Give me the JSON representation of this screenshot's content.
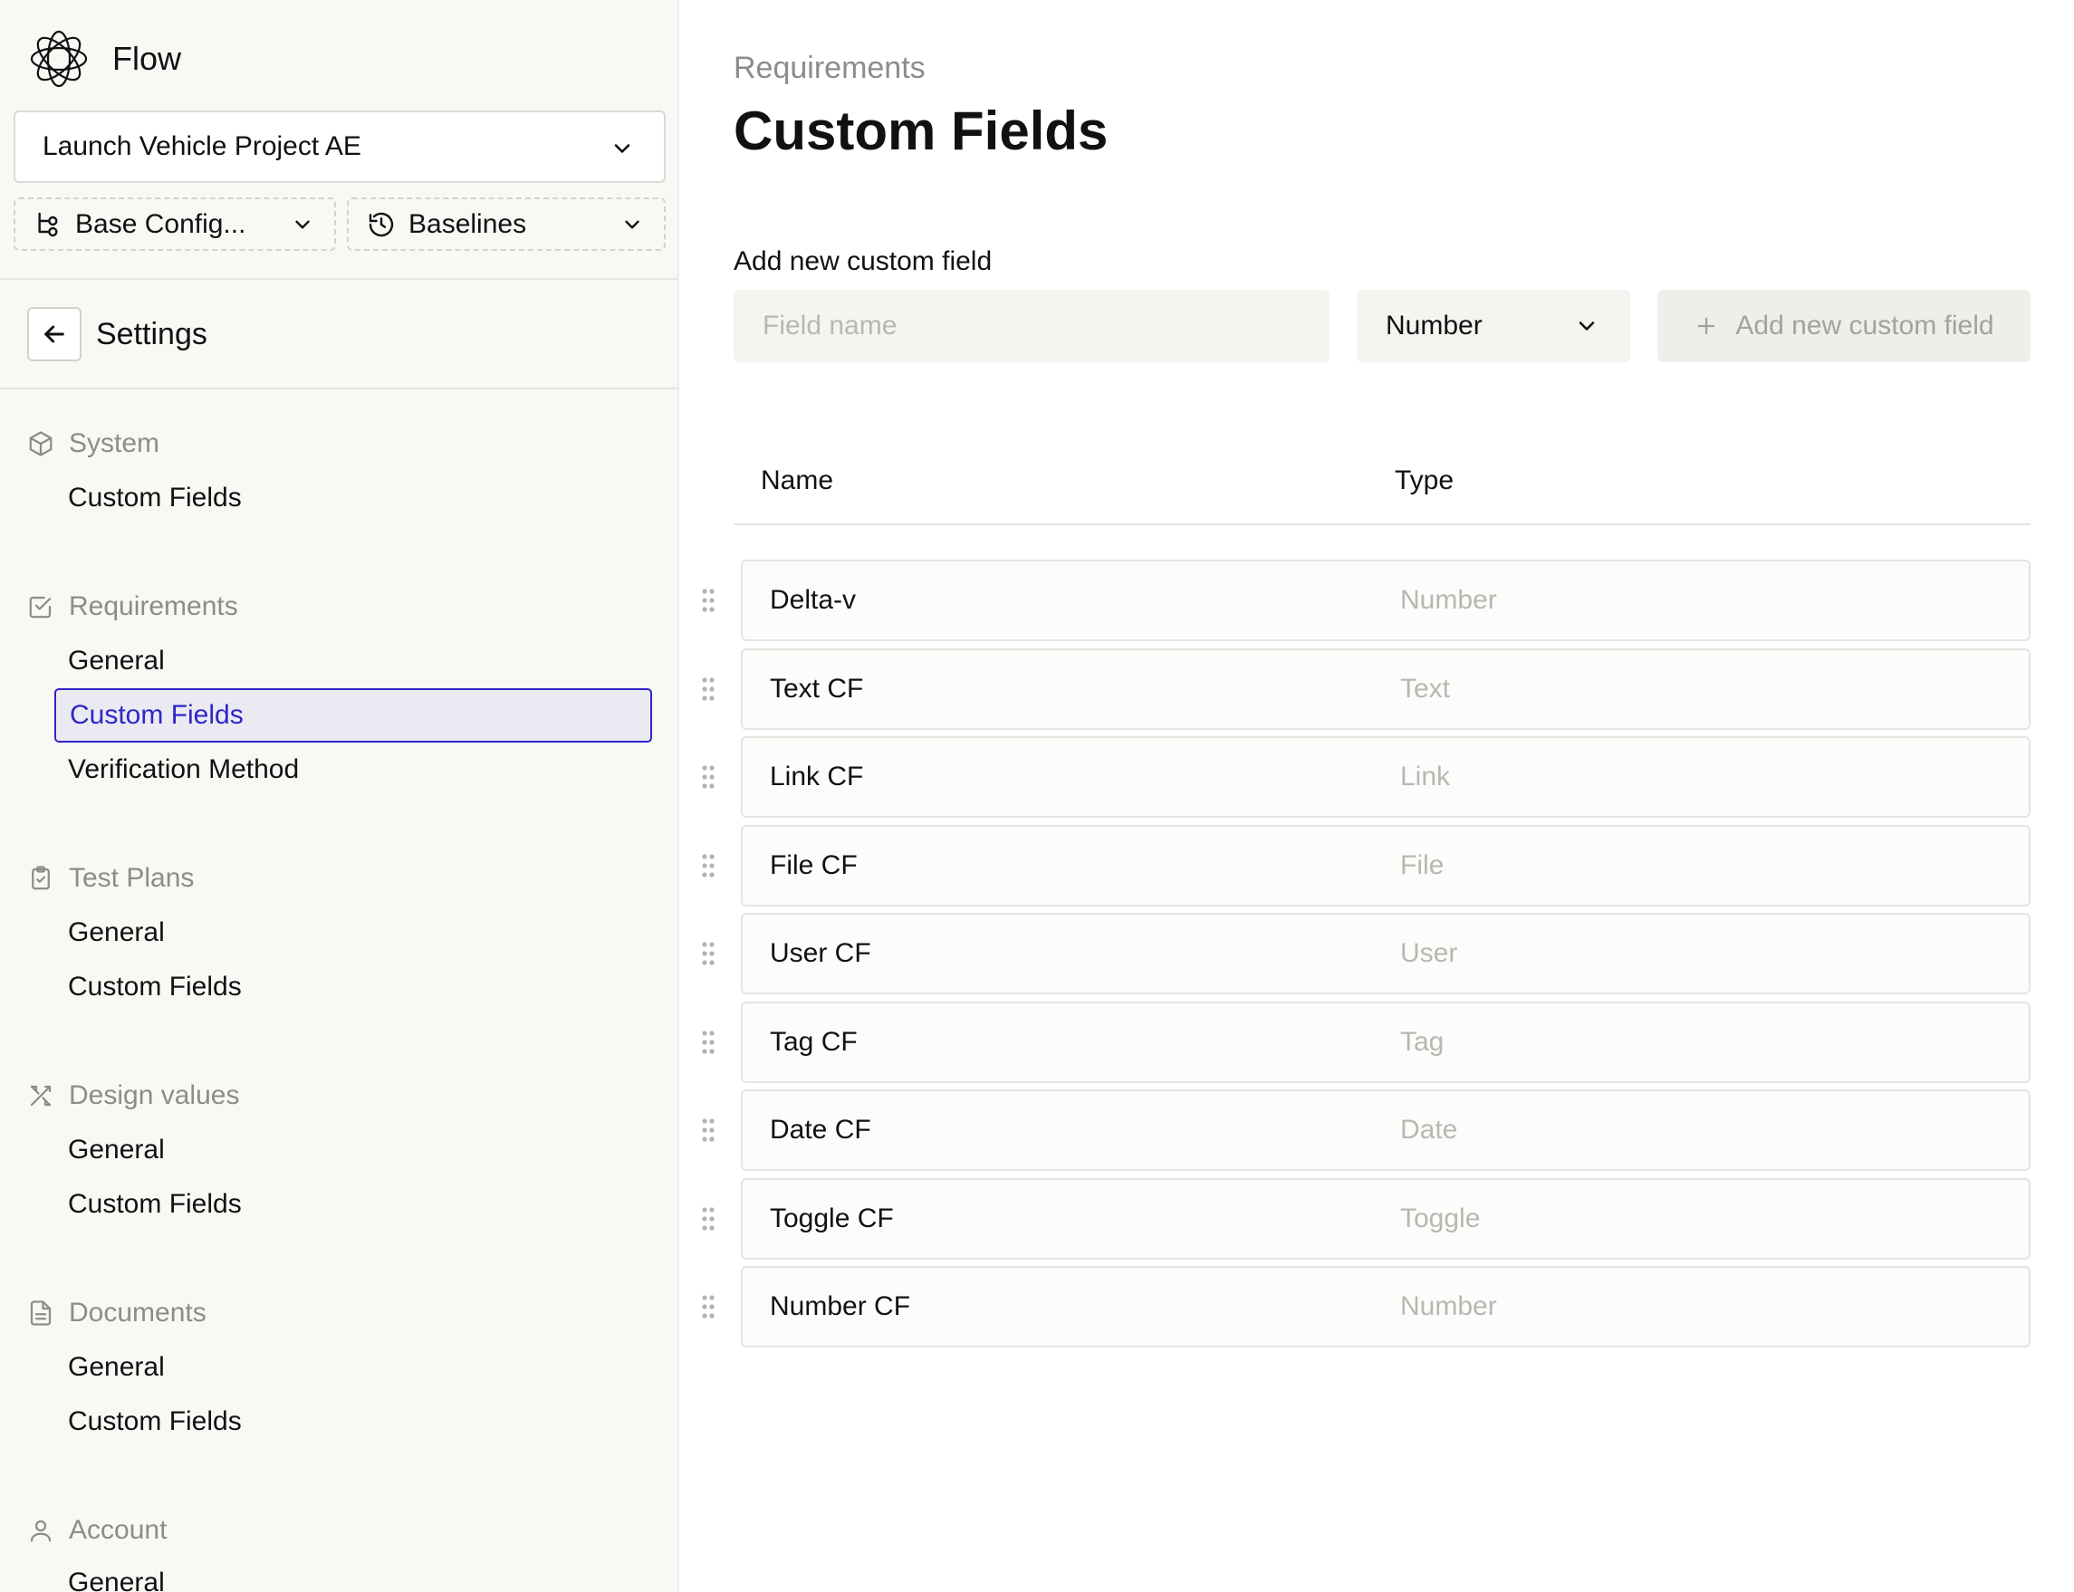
{
  "app": {
    "name": "Flow"
  },
  "project": {
    "selected": "Launch Vehicle Project AE"
  },
  "config": {
    "label": "Base Config..."
  },
  "baselines": {
    "label": "Baselines"
  },
  "settings": {
    "title": "Settings"
  },
  "sidebar": {
    "system": {
      "label": "System",
      "items": [
        "Custom Fields"
      ]
    },
    "requirements": {
      "label": "Requirements",
      "items": [
        "General",
        "Custom Fields",
        "Verification Method"
      ]
    },
    "test_plans": {
      "label": "Test Plans",
      "items": [
        "General",
        "Custom Fields"
      ]
    },
    "design_values": {
      "label": "Design values",
      "items": [
        "General",
        "Custom Fields"
      ]
    },
    "documents": {
      "label": "Documents",
      "items": [
        "General",
        "Custom Fields"
      ]
    },
    "account": {
      "label": "Account",
      "items": [
        "General"
      ]
    }
  },
  "main": {
    "breadcrumb": "Requirements",
    "title": "Custom Fields",
    "add_label": "Add new custom field",
    "field_placeholder": "Field name",
    "type_selected": "Number",
    "add_button": "Add new custom field",
    "columns": {
      "name": "Name",
      "type": "Type"
    },
    "rows": [
      {
        "name": "Delta-v",
        "type": "Number"
      },
      {
        "name": "Text CF",
        "type": "Text"
      },
      {
        "name": "Link CF",
        "type": "Link"
      },
      {
        "name": "File CF",
        "type": "File"
      },
      {
        "name": "User CF",
        "type": "User"
      },
      {
        "name": "Tag CF",
        "type": "Tag"
      },
      {
        "name": "Date CF",
        "type": "Date"
      },
      {
        "name": "Toggle CF",
        "type": "Toggle"
      },
      {
        "name": "Number CF",
        "type": "Number"
      }
    ]
  },
  "colors": {
    "accent": "#2f25c9",
    "active_bg": "#ebeaf2",
    "sidebar_bg": "#f9f8f5",
    "muted": "#8d8c88"
  }
}
